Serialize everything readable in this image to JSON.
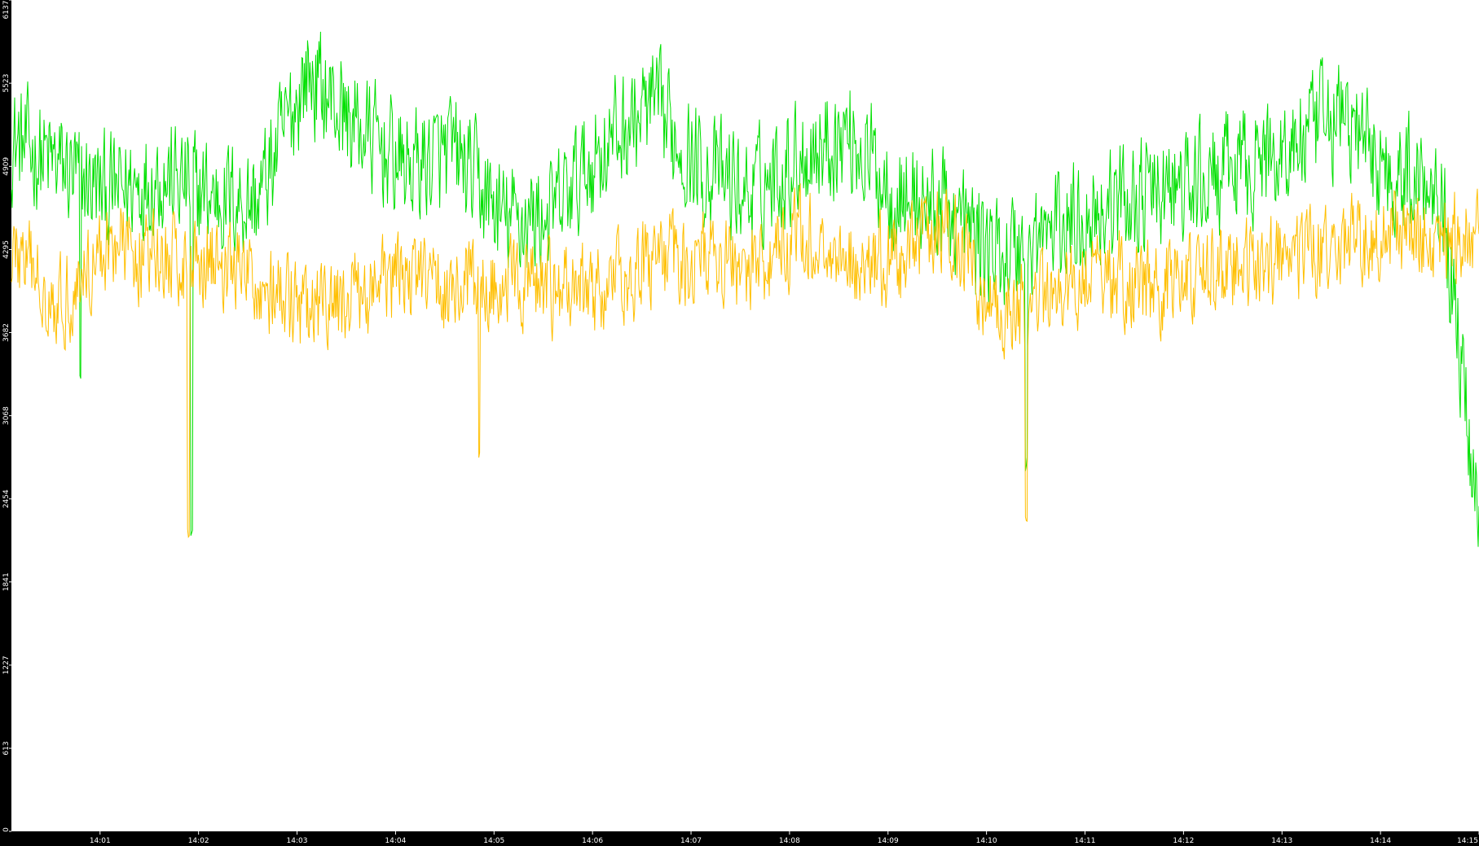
{
  "chart_data": {
    "type": "line",
    "title": "",
    "xlabel": "",
    "ylabel": "",
    "y_ticks": [
      0,
      613,
      1227,
      1841,
      2454,
      3068,
      3682,
      4295,
      4909,
      5523,
      6137
    ],
    "ylim": [
      0,
      6137
    ],
    "x_ticks": [
      "14:01",
      "14:02",
      "14:03",
      "14:04",
      "14:05",
      "14:06",
      "14:07",
      "14:08",
      "14:09",
      "14:10",
      "14:11",
      "14:12",
      "14:13",
      "14:14",
      "14:15"
    ],
    "x_tick_minutes": [
      1,
      2,
      3,
      4,
      5,
      6,
      7,
      8,
      9,
      10,
      11,
      12,
      13,
      14,
      15
    ],
    "xlim_minutes": [
      0.1,
      15.0
    ],
    "grid": false,
    "legend": "none",
    "background_color": "#000000",
    "plot_background_color": "#ffffff",
    "series": [
      {
        "color": "#00e000",
        "x_minutes": [
          0.1,
          0.6,
          1.1,
          1.6,
          2.1,
          2.6,
          3.1,
          3.6,
          4.1,
          4.6,
          5.1,
          5.6,
          6.1,
          6.6,
          7.1,
          7.6,
          8.1,
          8.6,
          9.1,
          9.6,
          10.1,
          10.6,
          11.1,
          11.6,
          12.1,
          12.6,
          13.1,
          13.6,
          14.1,
          14.6,
          15.0
        ],
        "values": [
          5100,
          4900,
          4700,
          4850,
          4700,
          4650,
          5600,
          5200,
          4900,
          5000,
          4500,
          4550,
          5050,
          5350,
          4900,
          4700,
          5000,
          5150,
          4700,
          4600,
          4250,
          4400,
          4600,
          4700,
          4750,
          4900,
          5050,
          5300,
          4850,
          4850,
          2300
        ],
        "volatility": 380,
        "min_value": 2100,
        "spikes": [
          {
            "x_minute": 0.8,
            "value": 3300
          },
          {
            "x_minute": 1.93,
            "value": 2200
          },
          {
            "x_minute": 10.4,
            "value": 2700
          }
        ]
      },
      {
        "color": "#ffbf00",
        "x_minutes": [
          0.1,
          0.6,
          1.1,
          1.6,
          2.1,
          2.6,
          3.1,
          3.6,
          4.1,
          4.6,
          5.1,
          5.6,
          6.1,
          6.6,
          7.1,
          7.6,
          8.1,
          8.6,
          9.1,
          9.6,
          10.1,
          10.6,
          11.1,
          11.6,
          12.1,
          12.6,
          13.1,
          13.6,
          14.1,
          14.6,
          15.0
        ],
        "values": [
          4300,
          3900,
          4350,
          4200,
          4250,
          4050,
          3800,
          3950,
          4100,
          4000,
          4050,
          4000,
          4000,
          4200,
          4250,
          4150,
          4400,
          4200,
          4200,
          4450,
          3800,
          3900,
          4150,
          4000,
          4100,
          4150,
          4250,
          4350,
          4400,
          4400,
          4400
        ],
        "volatility": 300,
        "min_value": 2100,
        "spikes": [
          {
            "x_minute": 1.9,
            "value": 2180
          },
          {
            "x_minute": 4.85,
            "value": 2750
          },
          {
            "x_minute": 10.4,
            "value": 2350
          }
        ]
      }
    ]
  }
}
